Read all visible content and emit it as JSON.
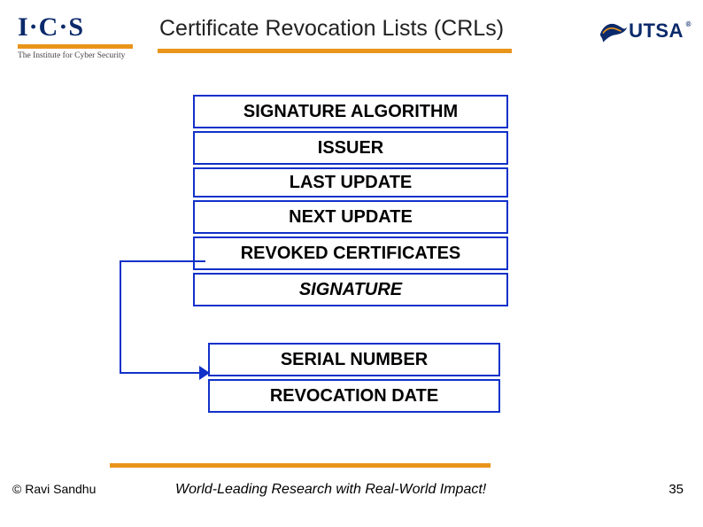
{
  "header": {
    "ics_letters": "I·C·S",
    "ics_subtitle": "The Institute for Cyber Security",
    "title": "Certificate Revocation Lists (CRLs)",
    "utsa_text": "UTSA",
    "utsa_reg": "®"
  },
  "diagram": {
    "main": [
      "SIGNATURE ALGORITHM",
      "ISSUER",
      "LAST UPDATE",
      "NEXT UPDATE",
      "REVOKED CERTIFICATES",
      "SIGNATURE"
    ],
    "detail": [
      "SERIAL NUMBER",
      "REVOCATION DATE"
    ]
  },
  "footer": {
    "copyright": "© Ravi  Sandhu",
    "tagline": "World-Leading Research with Real-World Impact!",
    "page_number": "35"
  }
}
